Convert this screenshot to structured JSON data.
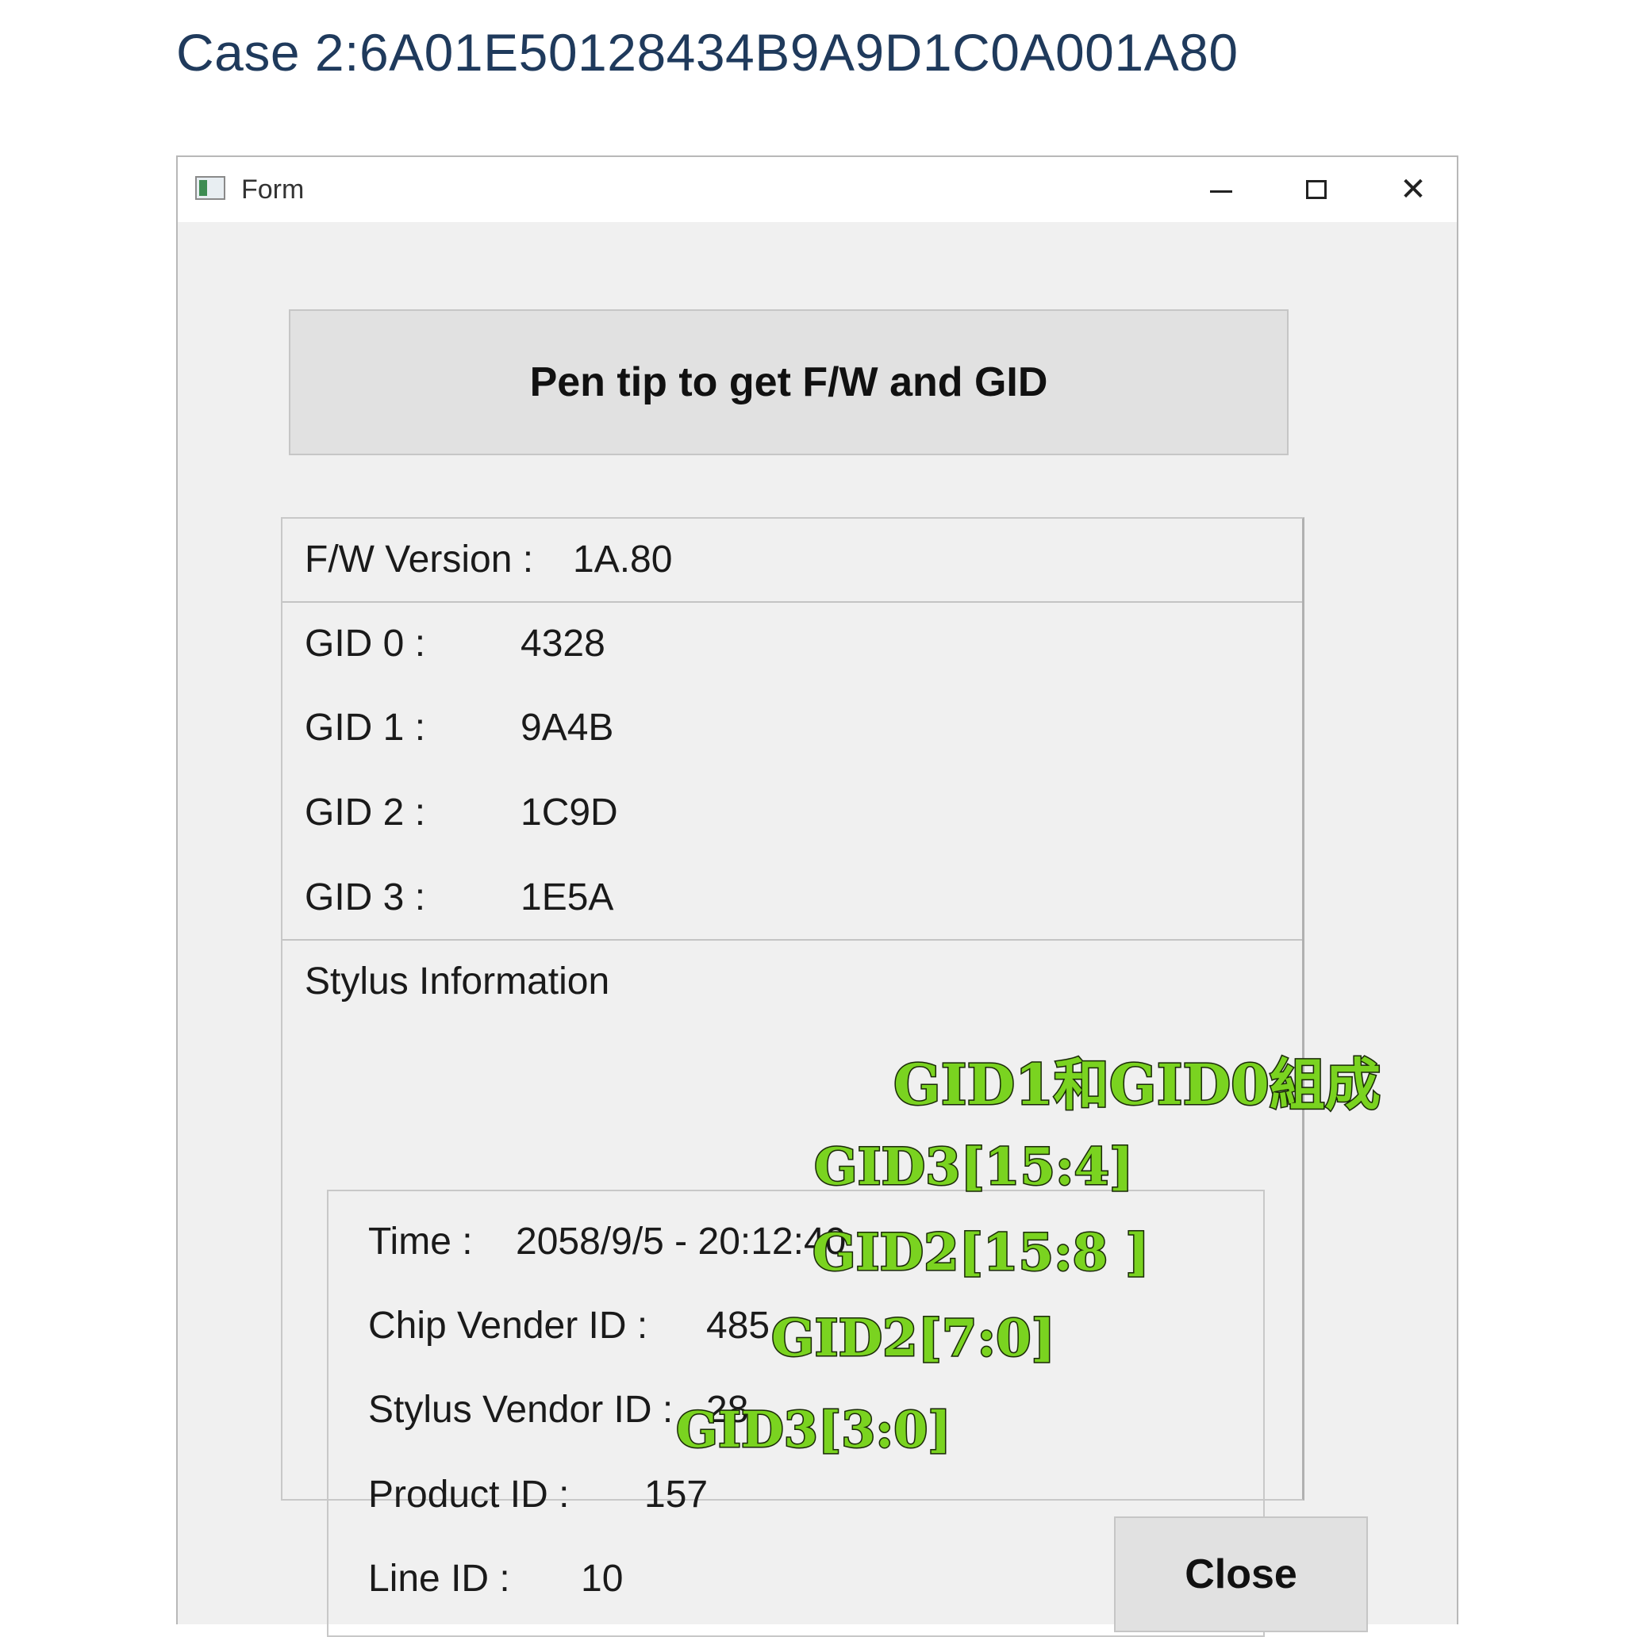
{
  "case_title": "Case 2:6A01E50128434B9A9D1C0A001A80",
  "window": {
    "title": "Form",
    "icons": {
      "app": "form-app-icon",
      "minimize": "minimize-icon",
      "maximize": "maximize-icon",
      "close": "close-icon"
    },
    "close_glyph": "✕"
  },
  "get_button_label": "Pen tip to get F/W and GID",
  "fw": {
    "label": "F/W Version :",
    "value": "1A.80"
  },
  "gids": [
    {
      "label": "GID 0 :",
      "value": "4328"
    },
    {
      "label": "GID 1 :",
      "value": "9A4B"
    },
    {
      "label": "GID 2 :",
      "value": "1C9D"
    },
    {
      "label": "GID 3 :",
      "value": "1E5A"
    }
  ],
  "stylus": {
    "section_label": "Stylus Information",
    "time": {
      "label": "Time :",
      "value": "2058/9/5 - 20:12:40"
    },
    "chip_vendor": {
      "label": "Chip Vender ID :",
      "value": "485"
    },
    "stylus_vendor": {
      "label": "Stylus Vendor ID :",
      "value": "28"
    },
    "product": {
      "label": "Product ID :",
      "value": "157"
    },
    "line": {
      "label": "Line ID :",
      "value": "10"
    }
  },
  "annotations": {
    "time": "GID1和GID0組成",
    "chip_vendor": "GID3[15:4]",
    "stylus_vendor": "GID2[15:8 ]",
    "product": "GID2[7:0]",
    "line": "GID3[3:0]",
    "color": "#7ad320"
  },
  "close_button_label": "Close"
}
